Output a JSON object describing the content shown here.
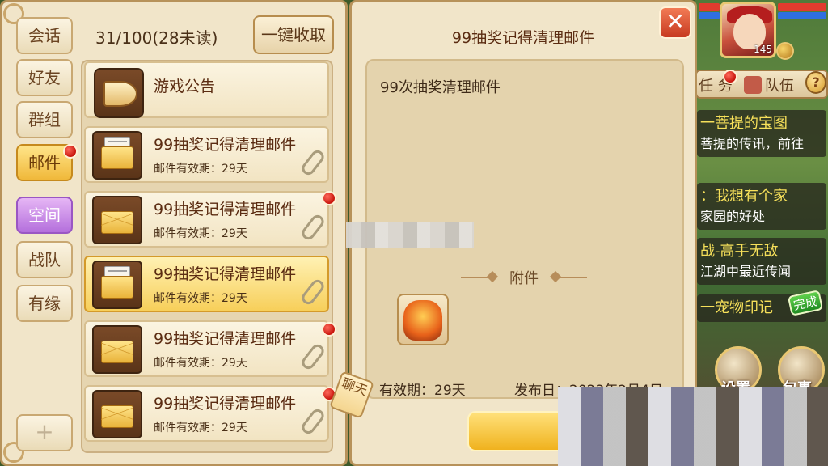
{
  "hud": {
    "player_level": "145",
    "tabs": [
      "任 务",
      "队伍"
    ],
    "help_icon": "?"
  },
  "quests": [
    {
      "title": "一菩提的宝图",
      "desc": "菩提的传讯，前往"
    },
    {
      "title": "：我想有个家",
      "desc": "家园的好处"
    },
    {
      "title": "战-高手无敌",
      "desc": "江湖中最近传闻"
    },
    {
      "title": "一宠物印记",
      "desc": ""
    }
  ],
  "done_badge": "完成",
  "round_buttons": [
    "设置",
    "包裹"
  ],
  "sidebar": {
    "items": [
      {
        "label": "会话"
      },
      {
        "label": "好友"
      },
      {
        "label": "群组"
      },
      {
        "label": "邮件"
      },
      {
        "label": "空间"
      },
      {
        "label": "战队"
      },
      {
        "label": "有缘"
      }
    ]
  },
  "mail_list": {
    "count": "31/100(28未读)",
    "collect_all": "一键收取",
    "notice": "游戏公告",
    "items": [
      {
        "title": "99抽奖记得清理邮件",
        "validity": "邮件有效期：29天"
      },
      {
        "title": "99抽奖记得清理邮件",
        "validity": "邮件有效期：29天"
      },
      {
        "title": "99抽奖记得清理邮件",
        "validity": "邮件有效期：29天"
      },
      {
        "title": "99抽奖记得清理邮件",
        "validity": "邮件有效期：29天"
      },
      {
        "title": "99抽奖记得清理邮件",
        "validity": "邮件有效期：29天"
      }
    ]
  },
  "chat_tag": "聊天",
  "detail": {
    "title": "99抽奖记得清理邮件",
    "content": "99次抽奖清理邮件",
    "attachment_label": "附件",
    "validity": "有效期：29天",
    "publish_date": "发布日：2023年2月4日"
  },
  "colors": {
    "panel_bg": "#f1e5c9",
    "panel_border": "#b7925a",
    "selected_item": "#f7cf5a",
    "unread_dot": "#c8150c"
  }
}
